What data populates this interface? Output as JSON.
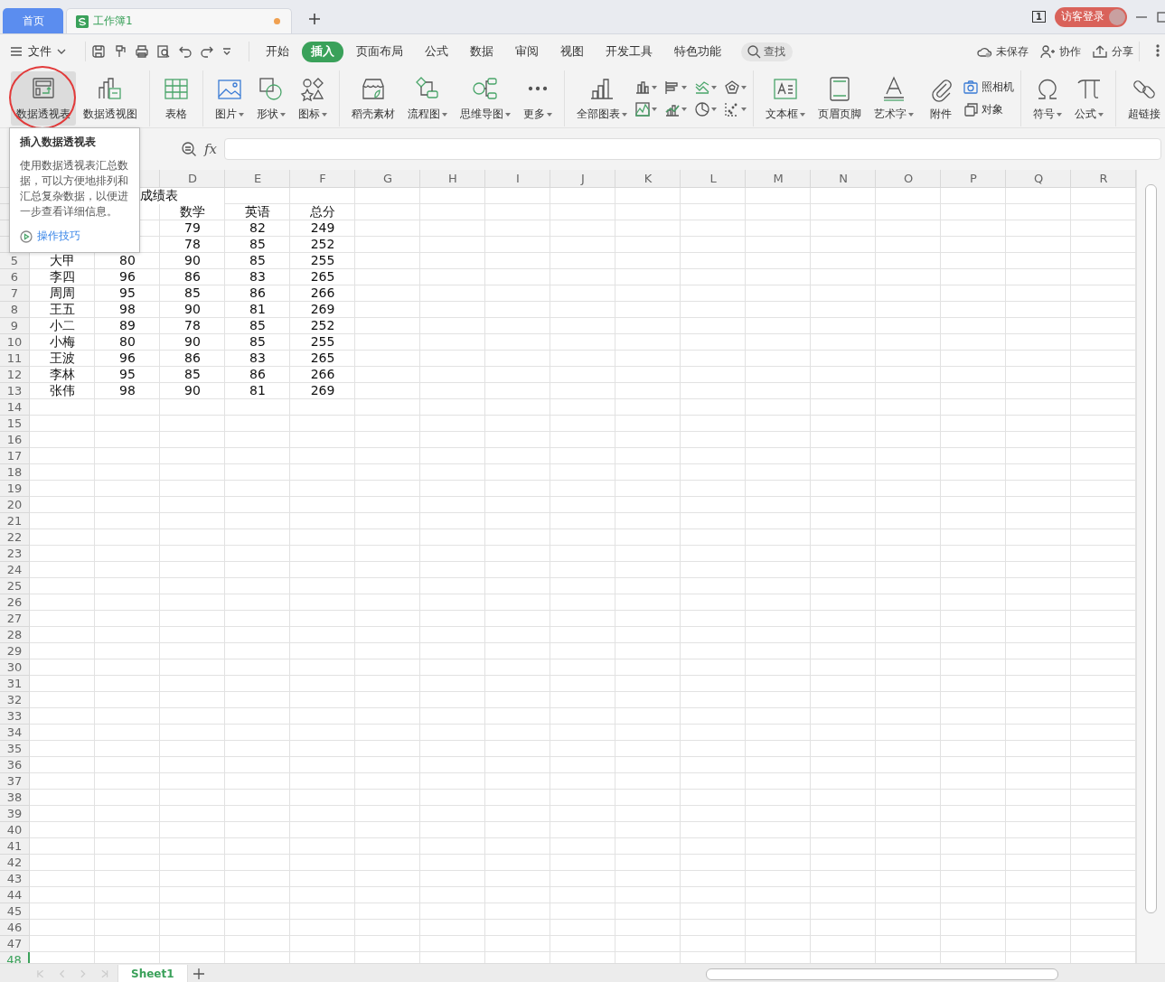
{
  "title_bar": {
    "tabs": [
      {
        "label": "首页",
        "kind": "home",
        "selected": false
      },
      {
        "label": "工作簿1",
        "kind": "sheet",
        "selected": true,
        "modified": true
      }
    ],
    "window_count": "1",
    "login_button": "访客登录"
  },
  "menu": {
    "file": "文件",
    "tabs": [
      {
        "label": "开始",
        "selected": false
      },
      {
        "label": "插入",
        "selected": true
      },
      {
        "label": "页面布局",
        "selected": false
      },
      {
        "label": "公式",
        "selected": false
      },
      {
        "label": "数据",
        "selected": false
      },
      {
        "label": "审阅",
        "selected": false
      },
      {
        "label": "视图",
        "selected": false
      },
      {
        "label": "开发工具",
        "selected": false
      },
      {
        "label": "特色功能",
        "selected": false
      }
    ],
    "search": "查找",
    "actions": [
      "未保存",
      "协作",
      "分享"
    ]
  },
  "ribbon": [
    {
      "items": [
        {
          "kind": "large",
          "label": "数据透视表",
          "dropdown": false,
          "hovered": true,
          "annotated": true
        },
        {
          "kind": "large",
          "label": "数据透视图",
          "dropdown": false,
          "hovered": false,
          "annotated": false
        }
      ]
    },
    {
      "items": [
        {
          "kind": "large",
          "label": "表格",
          "dropdown": false,
          "hovered": false,
          "annotated": false
        }
      ]
    },
    {
      "items": [
        {
          "kind": "large",
          "label": "图片",
          "dropdown": true,
          "hovered": false,
          "annotated": false
        },
        {
          "kind": "large",
          "label": "形状",
          "dropdown": true,
          "hovered": false,
          "annotated": false
        },
        {
          "kind": "large",
          "label": "图标",
          "dropdown": true,
          "hovered": false,
          "annotated": false
        }
      ]
    },
    {
      "items": [
        {
          "kind": "large",
          "label": "稻壳素材",
          "dropdown": false,
          "hovered": false,
          "annotated": false
        },
        {
          "kind": "large",
          "label": "流程图",
          "dropdown": true,
          "hovered": false,
          "annotated": false
        },
        {
          "kind": "large",
          "label": "思维导图",
          "dropdown": true,
          "hovered": false,
          "annotated": false
        },
        {
          "kind": "large",
          "label": "更多",
          "dropdown": true,
          "hovered": false,
          "annotated": false
        }
      ]
    },
    {
      "items": [
        {
          "kind": "large",
          "label": "全部图表",
          "dropdown": true,
          "hovered": false,
          "annotated": false
        },
        {
          "kind": "mini-grid",
          "buttons": [
            {
              "dropdown": true
            },
            {
              "dropdown": true
            },
            {
              "dropdown": true
            },
            {
              "dropdown": true
            },
            {
              "dropdown": true
            },
            {
              "dropdown": true
            },
            {
              "dropdown": true
            },
            {
              "dropdown": true
            }
          ]
        }
      ]
    },
    {
      "items": [
        {
          "kind": "large",
          "label": "文本框",
          "dropdown": true,
          "hovered": false,
          "annotated": false
        },
        {
          "kind": "large",
          "label": "页眉页脚",
          "dropdown": false,
          "hovered": false,
          "annotated": false
        },
        {
          "kind": "large",
          "label": "艺术字",
          "dropdown": true,
          "hovered": false,
          "annotated": false
        },
        {
          "kind": "large",
          "label": "附件",
          "dropdown": false,
          "hovered": false,
          "annotated": false
        },
        {
          "kind": "small-stack",
          "buttons": [
            {
              "label": "照相机"
            },
            {
              "label": "对象"
            }
          ]
        }
      ]
    },
    {
      "items": [
        {
          "kind": "large",
          "label": "符号",
          "dropdown": true,
          "hovered": false,
          "annotated": false
        },
        {
          "kind": "large",
          "label": "公式",
          "dropdown": true,
          "hovered": false,
          "annotated": false
        }
      ]
    },
    {
      "items": [
        {
          "kind": "large",
          "label": "超链接",
          "dropdown": false,
          "hovered": false,
          "annotated": false
        }
      ]
    }
  ],
  "tooltip": {
    "title": "插入数据透视表",
    "text": "使用数据透视表汇总数据，可以方便地排列和汇总复杂数据，以便进一步查看详细信息。",
    "link": "操作技巧"
  },
  "formula_bar": {
    "function_label": "fx"
  },
  "columns": [
    "D",
    "E",
    "F",
    "G",
    "H",
    "I",
    "J",
    "K",
    "L",
    "M",
    "N",
    "O",
    "P",
    "Q",
    "R"
  ],
  "rows": [
    {
      "title": "成绩表",
      "cells": {}
    },
    {
      "cells": {
        "D": "数学",
        "E": "英语",
        "F": "总分"
      }
    },
    {
      "cells": {
        "D": "79",
        "E": "82",
        "F": "249"
      }
    },
    {
      "cells": {
        "D": "78",
        "E": "85",
        "F": "252"
      }
    },
    {
      "row": "5",
      "selected": false,
      "cells": {
        "column_1": "大甲",
        "column_2": "80",
        "D": "90",
        "E": "85",
        "F": "255"
      }
    },
    {
      "row": "6",
      "selected": false,
      "cells": {
        "column_1": "李四",
        "column_2": "96",
        "D": "86",
        "E": "83",
        "F": "265"
      }
    },
    {
      "row": "7",
      "selected": false,
      "cells": {
        "column_1": "周周",
        "column_2": "95",
        "D": "85",
        "E": "86",
        "F": "266"
      }
    },
    {
      "row": "8",
      "selected": false,
      "cells": {
        "column_1": "王五",
        "column_2": "98",
        "D": "90",
        "E": "81",
        "F": "269"
      }
    },
    {
      "row": "9",
      "selected": false,
      "cells": {
        "column_1": "小二",
        "column_2": "89",
        "D": "78",
        "E": "85",
        "F": "252"
      }
    },
    {
      "row": "10",
      "selected": false,
      "cells": {
        "column_1": "小梅",
        "column_2": "80",
        "D": "90",
        "E": "85",
        "F": "255"
      }
    },
    {
      "row": "11",
      "selected": false,
      "cells": {
        "column_1": "王波",
        "column_2": "96",
        "D": "86",
        "E": "83",
        "F": "265"
      }
    },
    {
      "row": "12",
      "selected": false,
      "cells": {
        "column_1": "李林",
        "column_2": "95",
        "D": "85",
        "E": "86",
        "F": "266"
      }
    },
    {
      "row": "13",
      "selected": false,
      "cells": {
        "column_1": "张伟",
        "column_2": "98",
        "D": "90",
        "E": "81",
        "F": "269"
      }
    },
    {
      "row": "14",
      "selected": false,
      "cells": {}
    },
    {
      "row": "15",
      "selected": false,
      "cells": {}
    },
    {
      "row": "16",
      "selected": false,
      "cells": {}
    },
    {
      "row": "17",
      "selected": false,
      "cells": {}
    },
    {
      "row": "18",
      "selected": false,
      "cells": {}
    },
    {
      "row": "19",
      "selected": false,
      "cells": {}
    },
    {
      "row": "20",
      "selected": false,
      "cells": {}
    },
    {
      "row": "21",
      "selected": false,
      "cells": {}
    },
    {
      "row": "22",
      "selected": false,
      "cells": {}
    },
    {
      "row": "23",
      "selected": false,
      "cells": {}
    },
    {
      "row": "24",
      "selected": false,
      "cells": {}
    },
    {
      "row": "25",
      "selected": false,
      "cells": {}
    },
    {
      "row": "26",
      "selected": false,
      "cells": {}
    },
    {
      "row": "27",
      "selected": false,
      "cells": {}
    },
    {
      "row": "28",
      "selected": false,
      "cells": {}
    },
    {
      "row": "29",
      "selected": false,
      "cells": {}
    },
    {
      "row": "30",
      "selected": false,
      "cells": {}
    },
    {
      "row": "31",
      "selected": false,
      "cells": {}
    },
    {
      "row": "32",
      "selected": false,
      "cells": {}
    },
    {
      "row": "33",
      "selected": false,
      "cells": {}
    },
    {
      "row": "34",
      "selected": false,
      "cells": {}
    },
    {
      "row": "35",
      "selected": false,
      "cells": {}
    },
    {
      "row": "36",
      "selected": false,
      "cells": {}
    },
    {
      "row": "37",
      "selected": false,
      "cells": {}
    },
    {
      "row": "38",
      "selected": false,
      "cells": {}
    },
    {
      "row": "39",
      "selected": false,
      "cells": {}
    },
    {
      "row": "40",
      "selected": false,
      "cells": {}
    },
    {
      "row": "41",
      "selected": false,
      "cells": {}
    },
    {
      "row": "42",
      "selected": false,
      "cells": {}
    },
    {
      "row": "43",
      "selected": false,
      "cells": {}
    },
    {
      "row": "44",
      "selected": false,
      "cells": {}
    },
    {
      "row": "45",
      "selected": false,
      "cells": {}
    },
    {
      "row": "46",
      "selected": false,
      "cells": {}
    },
    {
      "row": "47",
      "selected": false,
      "cells": {}
    },
    {
      "row": "48",
      "selected": true,
      "cells": {}
    }
  ],
  "sheet_tabs": [
    {
      "label": "Sheet1",
      "selected": true
    }
  ]
}
